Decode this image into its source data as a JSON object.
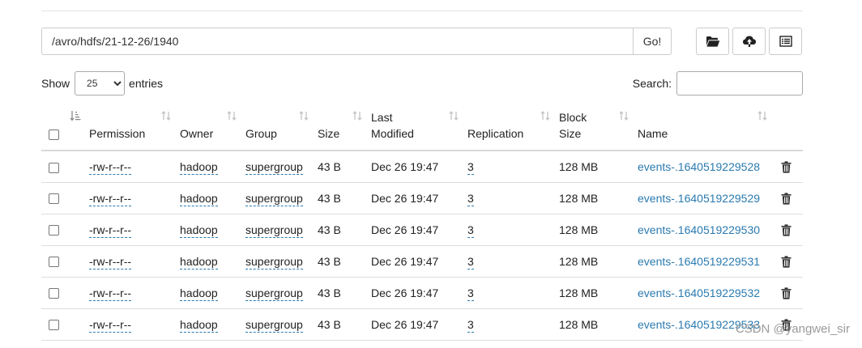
{
  "path": {
    "value": "/avro/hdfs/21-12-26/1940",
    "go_label": "Go!"
  },
  "toolbar": [
    {
      "icon": "folder-open-icon"
    },
    {
      "icon": "cloud-upload-icon"
    },
    {
      "icon": "list-icon"
    }
  ],
  "length": {
    "show_label": "Show",
    "selected": "25",
    "entries_label": "entries"
  },
  "search": {
    "label": "Search:",
    "value": ""
  },
  "table": {
    "headers": [
      "Permission",
      "Owner",
      "Group",
      "Size",
      "Last\nModified",
      "Replication",
      "Block\nSize",
      "Name"
    ],
    "rows": [
      [
        "-rw-r--r--",
        "hadoop",
        "supergroup",
        "43 B",
        "Dec 26 19:47",
        "3",
        "128 MB",
        "events-.1640519229528"
      ],
      [
        "-rw-r--r--",
        "hadoop",
        "supergroup",
        "43 B",
        "Dec 26 19:47",
        "3",
        "128 MB",
        "events-.1640519229529"
      ],
      [
        "-rw-r--r--",
        "hadoop",
        "supergroup",
        "43 B",
        "Dec 26 19:47",
        "3",
        "128 MB",
        "events-.1640519229530"
      ],
      [
        "-rw-r--r--",
        "hadoop",
        "supergroup",
        "43 B",
        "Dec 26 19:47",
        "3",
        "128 MB",
        "events-.1640519229531"
      ],
      [
        "-rw-r--r--",
        "hadoop",
        "supergroup",
        "43 B",
        "Dec 26 19:47",
        "3",
        "128 MB",
        "events-.1640519229532"
      ],
      [
        "-rw-r--r--",
        "hadoop",
        "supergroup",
        "43 B",
        "Dec 26 19:47",
        "3",
        "128 MB",
        "events-.1640519229533"
      ]
    ]
  },
  "watermark": "CSDN @yangwei_sir"
}
